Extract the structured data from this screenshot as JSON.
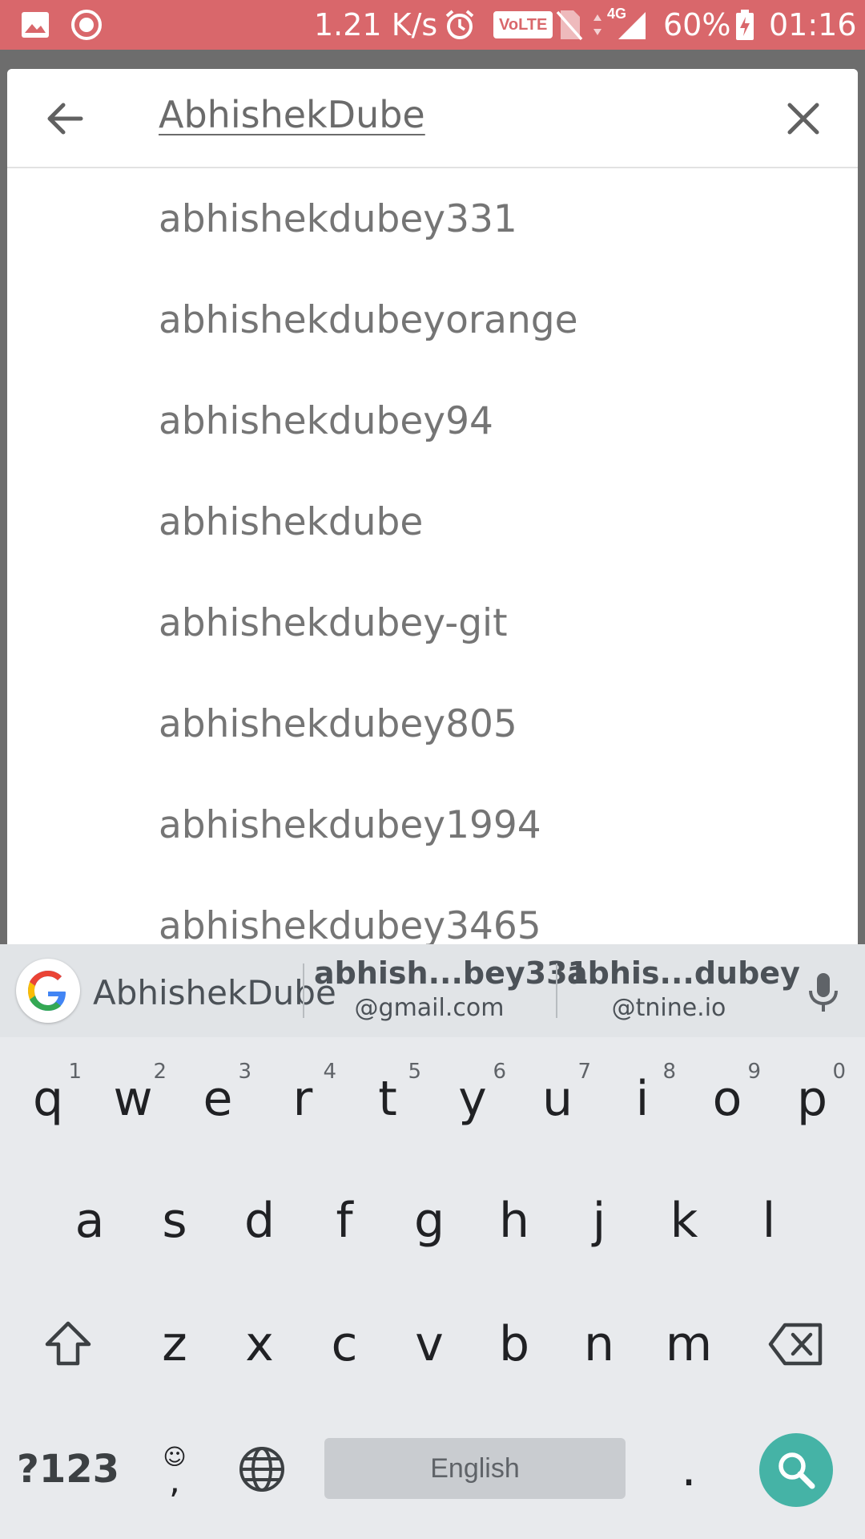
{
  "status_bar": {
    "speed": "1.21 K/s",
    "network_badge": "VoLTE",
    "network_type": "4G",
    "battery": "60%",
    "time": "01:16",
    "icons": [
      "gallery-icon",
      "record-icon",
      "alarm-icon",
      "volte-icon",
      "no-sim-icon",
      "data-arrows-icon",
      "signal-icon",
      "battery-charging-icon"
    ]
  },
  "search": {
    "query": "AbhishekDube",
    "back_icon": "arrow-back-icon",
    "clear_icon": "close-icon"
  },
  "suggestions": [
    "abhishekdubey331",
    "abhishekdubeyorange",
    "abhishekdubey94",
    "abhishekdube",
    "abhishekdubey-git",
    "abhishekdubey805",
    "abhishekdubey1994",
    "abhishekdubey3465"
  ],
  "keyboard": {
    "strip": {
      "typed_word": "AbhishekDube",
      "suggestion_1_line1": "abhish...bey331",
      "suggestion_1_line2": "@gmail.com",
      "suggestion_2_line1": "abhis...dubey",
      "suggestion_2_line2": "@tnine.io"
    },
    "row1": [
      {
        "key": "q",
        "hint": "1"
      },
      {
        "key": "w",
        "hint": "2"
      },
      {
        "key": "e",
        "hint": "3"
      },
      {
        "key": "r",
        "hint": "4"
      },
      {
        "key": "t",
        "hint": "5"
      },
      {
        "key": "y",
        "hint": "6"
      },
      {
        "key": "u",
        "hint": "7"
      },
      {
        "key": "i",
        "hint": "8"
      },
      {
        "key": "o",
        "hint": "9"
      },
      {
        "key": "p",
        "hint": "0"
      }
    ],
    "row2": [
      "a",
      "s",
      "d",
      "f",
      "g",
      "h",
      "j",
      "k",
      "l"
    ],
    "row3": [
      "z",
      "x",
      "c",
      "v",
      "b",
      "n",
      "m"
    ],
    "symbols_key": "?123",
    "comma_key": ",",
    "period_key": ".",
    "space_label": "English",
    "accent_color": "#45b3a6"
  }
}
